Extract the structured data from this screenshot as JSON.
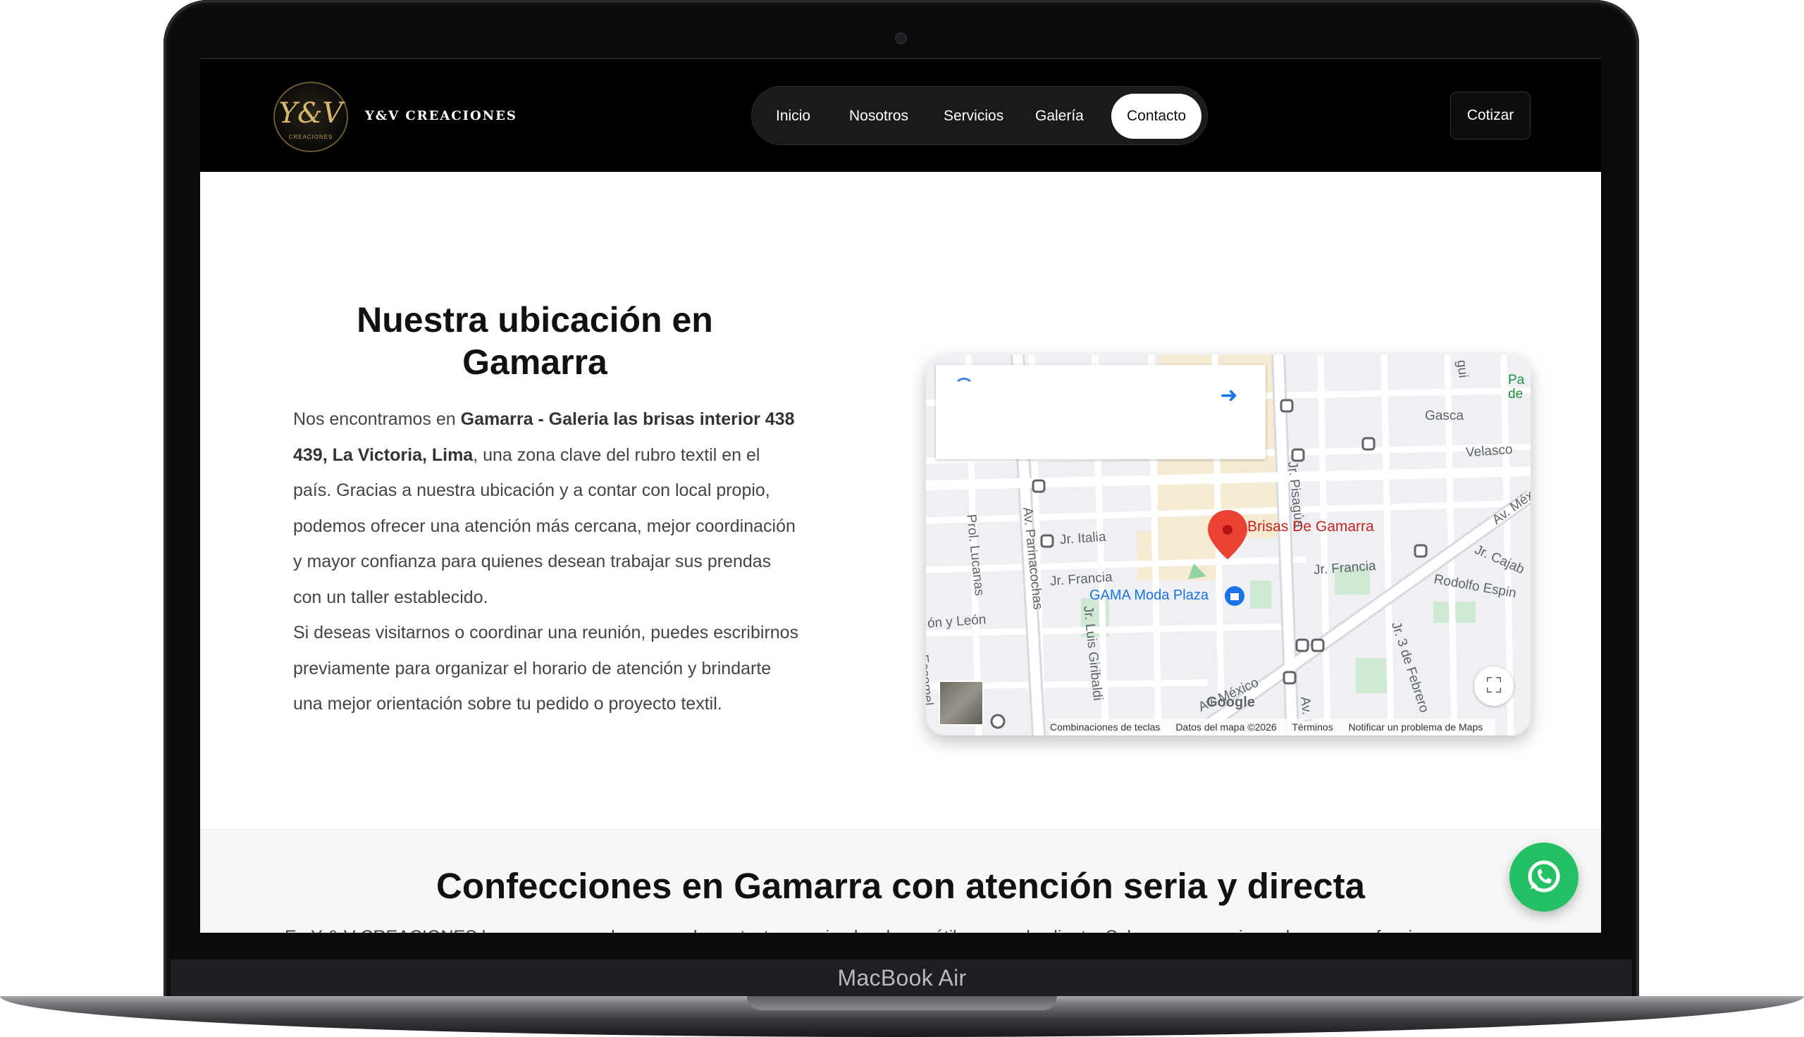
{
  "laptop": {
    "model_label": "MacBook Air"
  },
  "header": {
    "logo_monogram": "Y&V",
    "logo_subtext": "CREACIONES",
    "brand_name": "Y&V CREACIONES",
    "nav": [
      {
        "label": "Inicio"
      },
      {
        "label": "Nosotros"
      },
      {
        "label": "Servicios"
      },
      {
        "label": "Galería"
      },
      {
        "label": "Contacto",
        "active": true
      }
    ],
    "cta_label": "Cotizar"
  },
  "location": {
    "heading_line1": "Nuestra ubicación en",
    "heading_line2": "Gamarra",
    "intro": "Nos encontramos en ",
    "address": "Gamarra - Galeria las brisas interior 438 439, La Victoria, Lima",
    "after_address": ", una zona clave del rubro textil en el país. Gracias a nuestra ubicación y a contar con local propio, podemos ofrecer una atención más cercana, mejor coordinación y mayor confianza para quienes desean trabajar sus prendas con un taller establecido.",
    "paragraph2": "Si deseas visitarnos o coordinar una reunión, puedes escribirnos previamente para organizar el horario de atención y brindarte una mejor orientación sobre tu pedido o proyecto textil."
  },
  "map": {
    "place_label": "Brisas De Gamarra",
    "poi_label": "GAMA Moda Plaza",
    "street_labels": {
      "gasca": "Gasca",
      "velasco": "Velasco",
      "italia": "Jr. Italia",
      "francia_left": "Jr. Francia",
      "francia_right": "Jr. Francia",
      "pisagua": "Jr. Pisagúa",
      "lucanas": "Prol. Lucanas",
      "parinacochas": "Av. Parinacochas",
      "giribaldi": "Jr. Luis Giribaldi",
      "leon": "ón y León",
      "mexico": "Av. México",
      "rodolfo": "Rodolfo Espin",
      "cajabamba": "Jr. Cajab",
      "tres_febrero": "Jr. 3 de Febrero",
      "av_mex": "Av. Méx",
      "av_right": "Av. I",
      "escomel": "Escomel",
      "pa": "Pa de",
      "gui": "gui"
    },
    "google_logo": "Google",
    "attribution": {
      "shortcuts": "Combinaciones de teclas",
      "data": "Datos del mapa ©2026",
      "terms": "Términos",
      "report": "Notificar un problema de Maps"
    }
  },
  "section2": {
    "title": "Confecciones en Gamarra con atención seria y directa",
    "text": "En Y & V CREACIONES buscamos que el proceso de contacto sea simple, claro y útil para cada cliente. Sabemos que quienes buscan confecciones"
  }
}
